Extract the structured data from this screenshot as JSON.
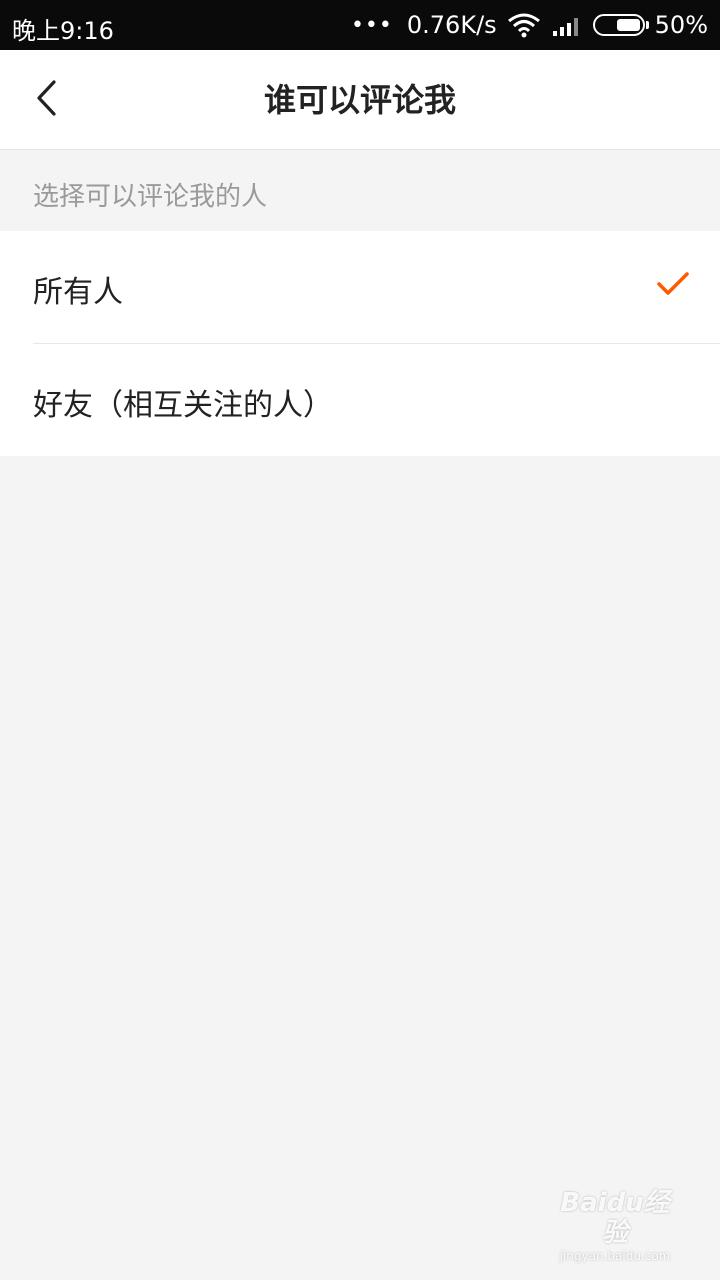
{
  "status_bar": {
    "time": "晚上9:16",
    "dots": "•••",
    "network_speed": "0.76K/s",
    "battery": "50%",
    "battery_level": 0.5,
    "icons": [
      "wifi-icon",
      "signal-icon",
      "battery-icon"
    ]
  },
  "nav": {
    "title": "谁可以评论我",
    "back_icon": "chevron-left-icon"
  },
  "section": {
    "header": "选择可以评论我的人"
  },
  "options": [
    {
      "label": "所有人",
      "selected": true
    },
    {
      "label": "好友（相互关注的人）",
      "selected": false
    }
  ],
  "colors": {
    "accent": "#ff5a00",
    "background": "#f4f4f4"
  },
  "watermark": {
    "main": "Baidu经验",
    "sub": "jingyan.baidu.com"
  }
}
